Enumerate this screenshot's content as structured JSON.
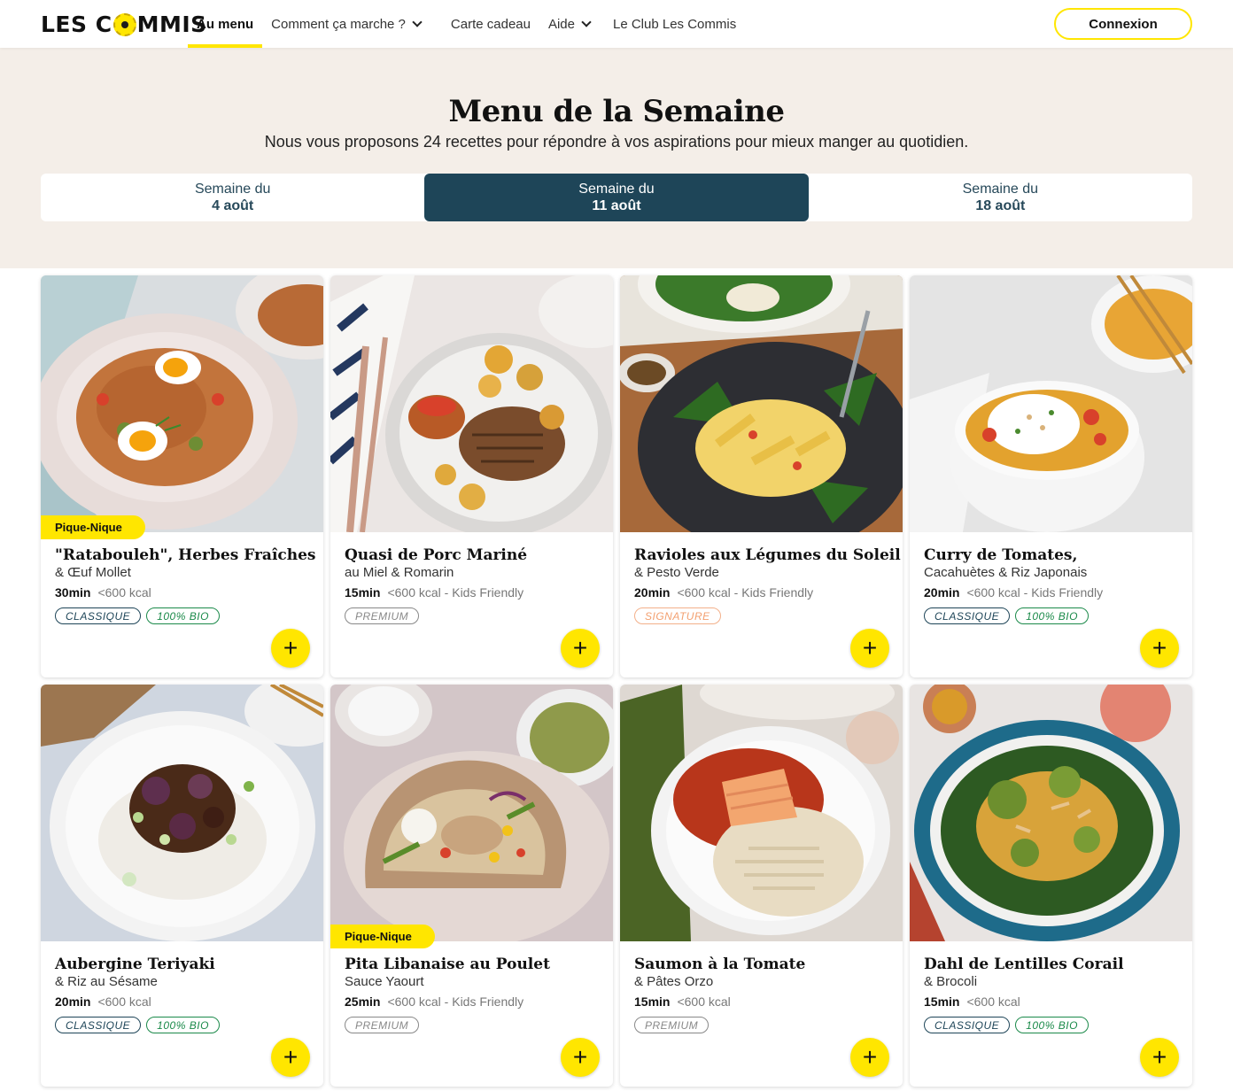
{
  "header": {
    "logo": "LES COMMIS",
    "nav": [
      {
        "label": "Au menu",
        "active": true,
        "dropdown": false
      },
      {
        "label": "Comment ça marche ?",
        "active": false,
        "dropdown": true
      },
      {
        "label": "Carte cadeau",
        "active": false,
        "dropdown": false
      },
      {
        "label": "Aide",
        "active": false,
        "dropdown": true
      },
      {
        "label": "Le Club Les Commis",
        "active": false,
        "dropdown": false
      }
    ],
    "login_label": "Connexion"
  },
  "hero": {
    "title": "Menu de la Semaine",
    "subtitle": "Nous vous proposons 24 recettes pour répondre à vos aspirations pour mieux manger au quotidien.",
    "weeks": [
      {
        "line1": "Semaine du",
        "line2": "4 août",
        "active": false
      },
      {
        "line1": "Semaine du",
        "line2": "11 août",
        "active": true
      },
      {
        "line1": "Semaine du",
        "line2": "18 août",
        "active": false
      }
    ]
  },
  "recipes": [
    {
      "badge": "Pique-Nique",
      "title": "\"Ratabouleh\", Herbes Fraîches",
      "subtitle": "& Œuf Mollet",
      "time": "30min",
      "info": "<600 kcal",
      "tags": [
        "CLASSIQUE",
        "100% BIO"
      ],
      "image": "ratabouleh-bowl-image",
      "add_label": "+"
    },
    {
      "badge": "",
      "title": "Quasi de Porc Mariné",
      "subtitle": "au Miel & Romarin",
      "time": "15min",
      "info": "<600 kcal - Kids Friendly",
      "tags": [
        "PREMIUM"
      ],
      "image": "pork-potatoes-plate-image",
      "add_label": "+"
    },
    {
      "badge": "",
      "title": "Ravioles aux Légumes du Soleil",
      "subtitle": "& Pesto Verde",
      "time": "20min",
      "info": "<600 kcal - Kids Friendly",
      "tags": [
        "SIGNATURE"
      ],
      "image": "ravioli-spinach-plate-image",
      "add_label": "+"
    },
    {
      "badge": "",
      "title": "Curry de Tomates,",
      "subtitle": "Cacahuètes & Riz Japonais",
      "time": "20min",
      "info": "<600 kcal - Kids Friendly",
      "tags": [
        "CLASSIQUE",
        "100% BIO"
      ],
      "image": "tomato-curry-rice-bowl-image",
      "add_label": "+"
    },
    {
      "badge": "",
      "title": "Aubergine Teriyaki",
      "subtitle": "& Riz au Sésame",
      "time": "20min",
      "info": "<600 kcal",
      "tags": [
        "CLASSIQUE",
        "100% BIO"
      ],
      "image": "aubergine-teriyaki-rice-image",
      "add_label": "+"
    },
    {
      "badge": "Pique-Nique",
      "title": "Pita Libanaise au Poulet",
      "subtitle": "Sauce Yaourt",
      "time": "25min",
      "info": "<600 kcal - Kids Friendly",
      "tags": [
        "PREMIUM"
      ],
      "image": "chicken-pita-image",
      "add_label": "+"
    },
    {
      "badge": "",
      "title": "Saumon à la Tomate",
      "subtitle": "& Pâtes Orzo",
      "time": "15min",
      "info": "<600 kcal",
      "tags": [
        "PREMIUM"
      ],
      "image": "salmon-orzo-image",
      "add_label": "+"
    },
    {
      "badge": "",
      "title": "Dahl de Lentilles Corail",
      "subtitle": "& Brocoli",
      "time": "15min",
      "info": "<600 kcal",
      "tags": [
        "CLASSIQUE",
        "100% BIO"
      ],
      "image": "lentil-dahl-broccoli-image",
      "add_label": "+"
    }
  ],
  "colors": {
    "brand_yellow": "#ffe600",
    "dark_teal": "#1e4558",
    "hero_bg": "#f4eee8",
    "bio_green": "#1b8a4a",
    "signature_orange": "#f3a070"
  }
}
